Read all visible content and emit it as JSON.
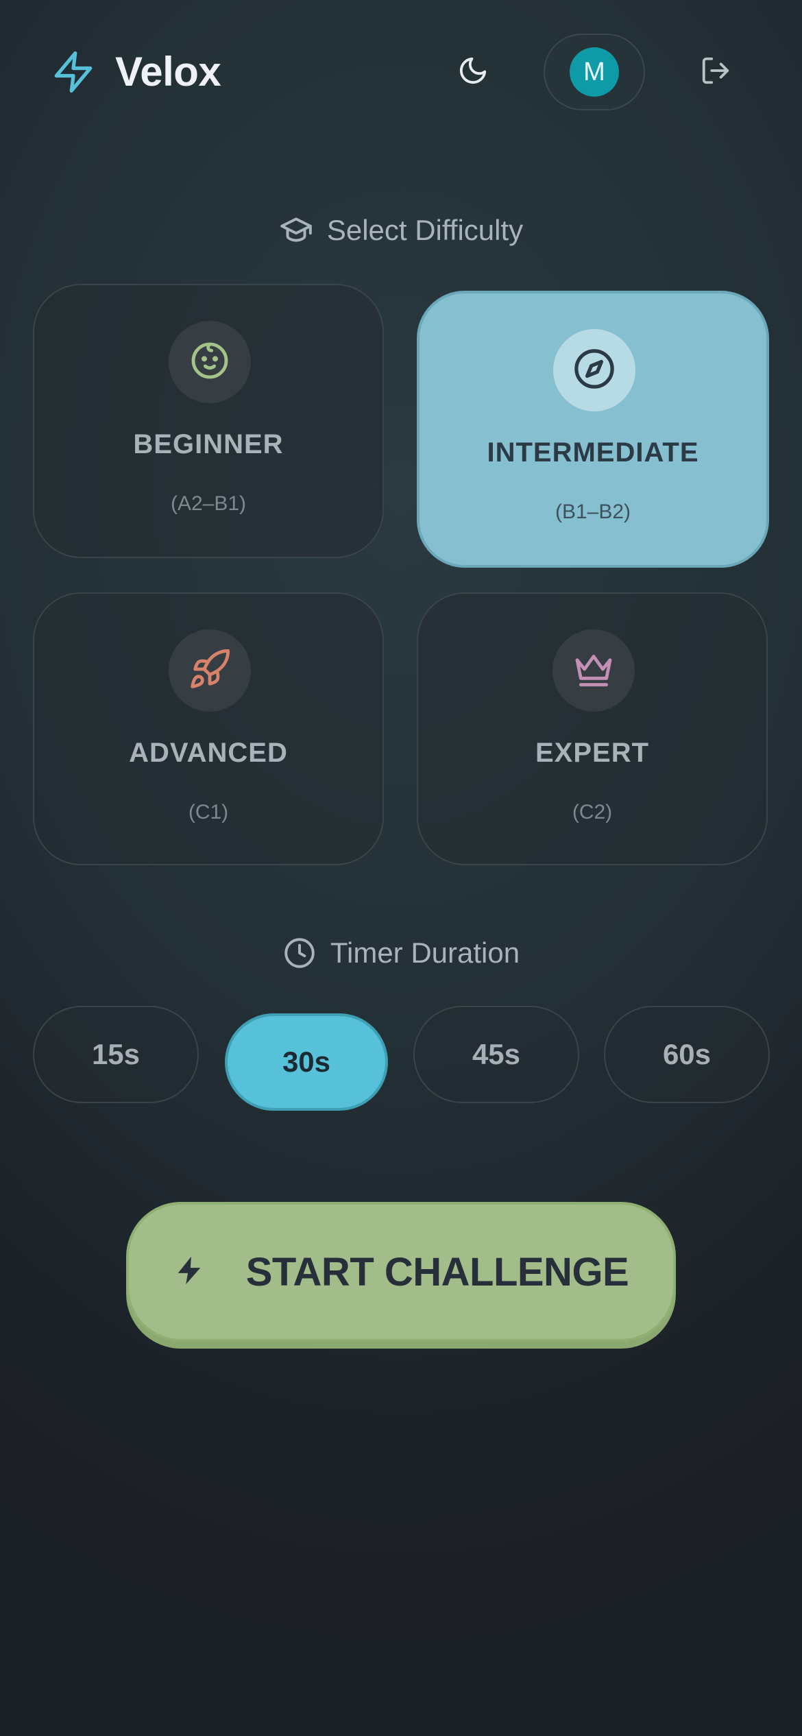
{
  "app": {
    "name": "Velox"
  },
  "header": {
    "avatar_initial": "M",
    "theme_icon": "moon-icon",
    "logout_icon": "logout-icon",
    "logo_icon": "bolt-icon"
  },
  "difficulty": {
    "heading": "Select Difficulty",
    "heading_icon": "graduation-cap-icon",
    "selected": "intermediate",
    "levels": [
      {
        "id": "beginner",
        "label": "BEGINNER",
        "range": "(A2–B1)",
        "icon": "baby-face-icon",
        "color": "#a3c489"
      },
      {
        "id": "intermediate",
        "label": "INTERMEDIATE",
        "range": "(B1–B2)",
        "icon": "compass-icon",
        "color": "#2b3a44"
      },
      {
        "id": "advanced",
        "label": "ADVANCED",
        "range": "(C1)",
        "icon": "rocket-icon",
        "color": "#d9826a"
      },
      {
        "id": "expert",
        "label": "EXPERT",
        "range": "(C2)",
        "icon": "crown-icon",
        "color": "#c48fb5"
      }
    ]
  },
  "timer": {
    "heading": "Timer Duration",
    "heading_icon": "clock-icon",
    "selected": "30s",
    "options": [
      "15s",
      "30s",
      "45s",
      "60s"
    ]
  },
  "start": {
    "label": "START CHALLENGE",
    "icon": "bolt-icon"
  },
  "colors": {
    "accent_teal": "#56c1d8",
    "selected_card": "#86bfcf",
    "start_green": "#a3bd8a",
    "avatar_bg": "#0f9aa7"
  }
}
